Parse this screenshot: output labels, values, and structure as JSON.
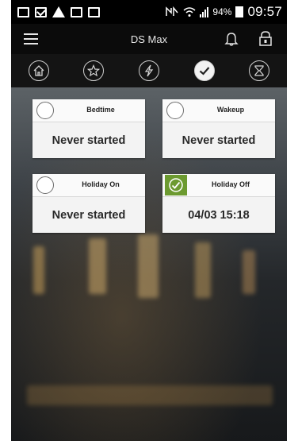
{
  "status_bar": {
    "battery": "94%",
    "time": "09:57"
  },
  "app_bar": {
    "title": "DS Max"
  },
  "tabs": [
    {
      "icon": "home-icon",
      "active": false
    },
    {
      "icon": "star-icon",
      "active": false
    },
    {
      "icon": "lightning-icon",
      "active": false
    },
    {
      "icon": "checkmark-icon",
      "active": true
    },
    {
      "icon": "hourglass-icon",
      "active": false
    }
  ],
  "scenes": [
    {
      "name": "Bedtime",
      "status": "Never started",
      "checked": false
    },
    {
      "name": "Wakeup",
      "status": "Never started",
      "checked": false
    },
    {
      "name": "Holiday On",
      "status": "Never started",
      "checked": false
    },
    {
      "name": "Holiday Off",
      "status": "04/03 15:18",
      "checked": true
    }
  ],
  "colors": {
    "accent_green": "#6c9a30",
    "header_black": "#0b0b0b"
  }
}
